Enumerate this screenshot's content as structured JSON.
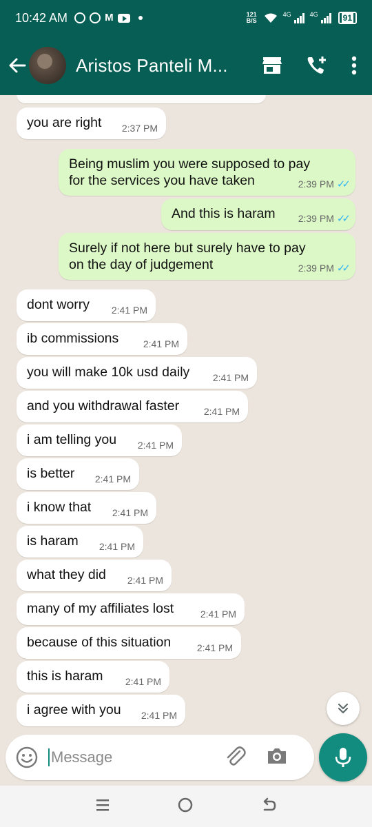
{
  "status_bar": {
    "time": "10:42 AM",
    "net_speed_top": "121",
    "net_speed_bottom": "B/S",
    "sim1_label": "4G",
    "sim2_label": "4G",
    "battery": "91"
  },
  "header": {
    "contact_name": "Aristos Panteli M...",
    "icons": [
      "back-arrow-icon",
      "shop-icon",
      "add-call-icon",
      "more-vert-icon"
    ]
  },
  "messages": [
    {
      "dir": "in",
      "text": "you are right",
      "time": "2:37 PM"
    },
    {
      "dir": "out",
      "text": "Being muslim you were supposed to pay for the services you have taken",
      "time": "2:39 PM",
      "ticks": "✓✓"
    },
    {
      "dir": "out",
      "text": "And this is haram",
      "time": "2:39 PM",
      "ticks": "✓✓"
    },
    {
      "dir": "out",
      "text": "Surely if not here but surely have to pay on the day of judgement",
      "time": "2:39 PM",
      "ticks": "✓✓"
    },
    {
      "dir": "in",
      "text": "dont worry",
      "time": "2:41 PM"
    },
    {
      "dir": "in",
      "text": "ib commissions",
      "time": "2:41 PM"
    },
    {
      "dir": "in",
      "text": "you will make 10k usd daily",
      "time": "2:41 PM"
    },
    {
      "dir": "in",
      "text": "and you withdrawal faster",
      "time": "2:41 PM"
    },
    {
      "dir": "in",
      "text": "i am telling you",
      "time": "2:41 PM"
    },
    {
      "dir": "in",
      "text": "is better",
      "time": "2:41 PM"
    },
    {
      "dir": "in",
      "text": "i know that",
      "time": "2:41 PM"
    },
    {
      "dir": "in",
      "text": "is haram",
      "time": "2:41 PM"
    },
    {
      "dir": "in",
      "text": "what they did",
      "time": "2:41 PM"
    },
    {
      "dir": "in",
      "text": "many of my affiliates lost",
      "time": "2:41 PM"
    },
    {
      "dir": "in",
      "text": "because of this situation",
      "time": "2:41 PM"
    },
    {
      "dir": "in",
      "text": "this is haram",
      "time": "2:41 PM"
    },
    {
      "dir": "in",
      "text": "i agree with you",
      "time": "2:41 PM"
    }
  ],
  "composer": {
    "placeholder": "Message"
  },
  "colors": {
    "header": "#075e54",
    "accent": "#128c7e",
    "outgoing_bubble": "#dcf8c6",
    "incoming_bubble": "#ffffff",
    "chat_bg": "#ece5dd",
    "read_ticks": "#34b7f1"
  }
}
